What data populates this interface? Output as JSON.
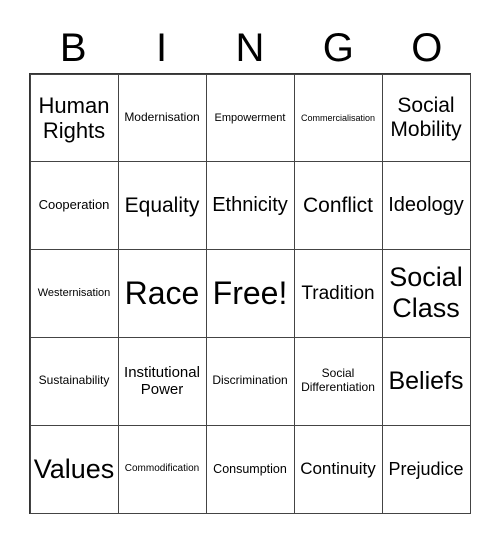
{
  "header": {
    "letters": [
      "B",
      "I",
      "N",
      "G",
      "O"
    ]
  },
  "cells": [
    "Human Rights",
    "Modernisation",
    "Empowerment",
    "Commercialisation",
    "Social Mobility",
    "Cooperation",
    "Equality",
    "Ethnicity",
    "Conflict",
    "Ideology",
    "Westernisation",
    "Race",
    "Free!",
    "Tradition",
    "Social Class",
    "Sustainability",
    "Institutional Power",
    "Discrimination",
    "Social Differentiation",
    "Beliefs",
    "Values",
    "Commodification",
    "Consumption",
    "Continuity",
    "Prejudice"
  ]
}
